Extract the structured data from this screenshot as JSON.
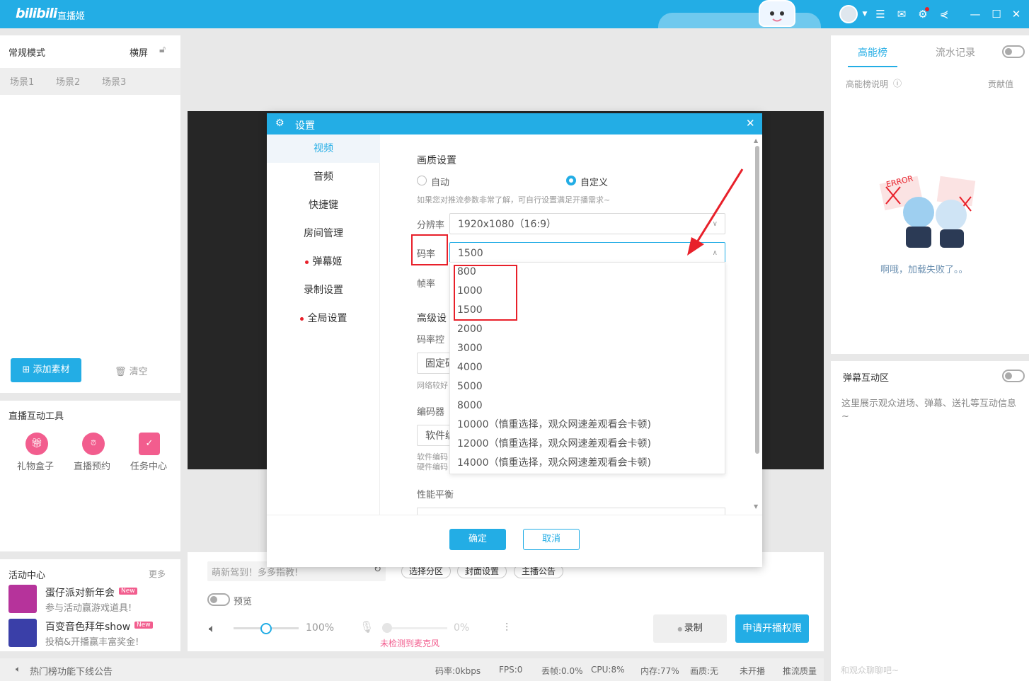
{
  "titlebar": {
    "logo": "bilibili",
    "app_name": "直播姬"
  },
  "left": {
    "mode": "常规模式",
    "orientation": "横屏",
    "scenes": [
      "场景1",
      "场景2",
      "场景3"
    ],
    "add_material": "添加素材",
    "clear": "清空",
    "tools_title": "直播互动工具",
    "tools": [
      "礼物盒子",
      "直播预约",
      "任务中心"
    ],
    "activity_title": "活动中心",
    "more": "更多",
    "activities": [
      {
        "title": "蛋仔派对新年会",
        "badge": "New",
        "desc": "参与活动赢游戏道具!"
      },
      {
        "title": "百变音色拜年show",
        "badge": "New",
        "desc": "投稿&开播赢丰富奖金!"
      }
    ]
  },
  "dialog": {
    "title": "设置",
    "nav": [
      "视频",
      "音频",
      "快捷键",
      "房间管理",
      "弹幕姬",
      "录制设置",
      "全局设置"
    ],
    "quality_title": "画质设置",
    "radio_auto": "自动",
    "radio_custom": "自定义",
    "hint": "如果您对推流参数非常了解，可自行设置满足开播需求~",
    "resolution_label": "分辨率",
    "resolution_value": "1920x1080（16:9）",
    "bitrate_label": "码率",
    "bitrate_value": "1500",
    "fps_label": "帧率",
    "advanced_title": "高级设",
    "rate_control_label": "码率控",
    "rate_control_value": "固定码",
    "network_hint": "网络较好",
    "encoder_label": "编码器",
    "encoder_value": "软件编",
    "encoder_hint1": "软件编码",
    "encoder_hint2": "硬件编码",
    "perf_label": "性能平衡",
    "bitrate_options": [
      "800",
      "1000",
      "1500",
      "2000",
      "3000",
      "4000",
      "5000",
      "8000",
      "10000（慎重选择，观众网速差观看会卡顿)",
      "12000（慎重选择，观众网速差观看会卡顿)",
      "14000（慎重选择，观众网速差观看会卡顿)"
    ],
    "ok": "确定",
    "cancel": "取消"
  },
  "bottom": {
    "title_placeholder": "萌新驾到！多多指教!",
    "tags": [
      "选择分区",
      "封面设置",
      "主播公告"
    ],
    "preview": "预览",
    "volume": "100%",
    "mic_volume": "0%",
    "mic_warning": "未检测到麦克风",
    "record": "录制",
    "apply": "申请开播权限"
  },
  "right": {
    "tab_active": "高能榜",
    "tab_other": "流水记录",
    "explain": "高能榜说明",
    "contrib": "贡献值",
    "error_text": "ERROR",
    "load_fail": "啊哦，加载失败了。。",
    "danmu_title": "弹幕互动区",
    "danmu_desc": "这里展示观众进场、弹幕、送礼等互动信息~",
    "chat_placeholder": "和观众聊聊吧~"
  },
  "status": {
    "notice": "热门榜功能下线公告",
    "bitrate": "码率:0kbps",
    "fps": "FPS:0",
    "drop": "丢帧:0.0%",
    "cpu": "CPU:8%",
    "mem": "内存:77%",
    "quality": "画质:无",
    "live": "未开播",
    "push": "推流质量"
  },
  "colors": {
    "accent": "#23ade5",
    "red": "#e8202a"
  }
}
